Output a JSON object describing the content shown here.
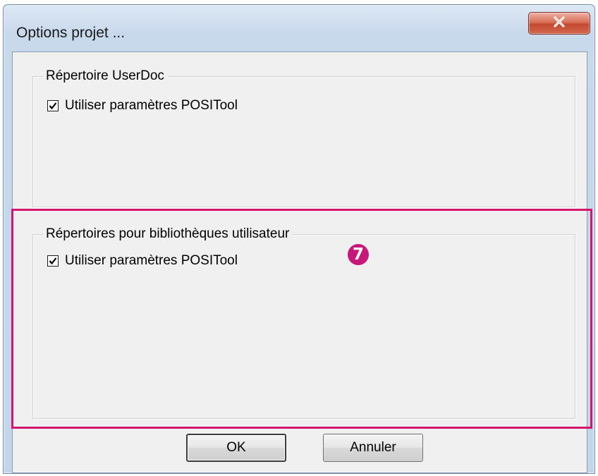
{
  "window": {
    "title": "Options projet ...",
    "close_label": "X"
  },
  "groups": [
    {
      "legend": "Répertoire UserDoc",
      "checkbox_label": "Utiliser paramètres POSITool",
      "checked": true
    },
    {
      "legend": "Répertoires pour bibliothèques utilisateur",
      "checkbox_label": "Utiliser paramètres POSITool",
      "checked": true
    }
  ],
  "annotation": {
    "badge_number": "7",
    "highlight_color": "#d4166f",
    "badge_color": "#c8177a"
  },
  "buttons": {
    "ok_label": "OK",
    "cancel_label": "Annuler"
  },
  "colors": {
    "close_button": "#c44a31",
    "dialog_background": "#f0f0f0"
  }
}
